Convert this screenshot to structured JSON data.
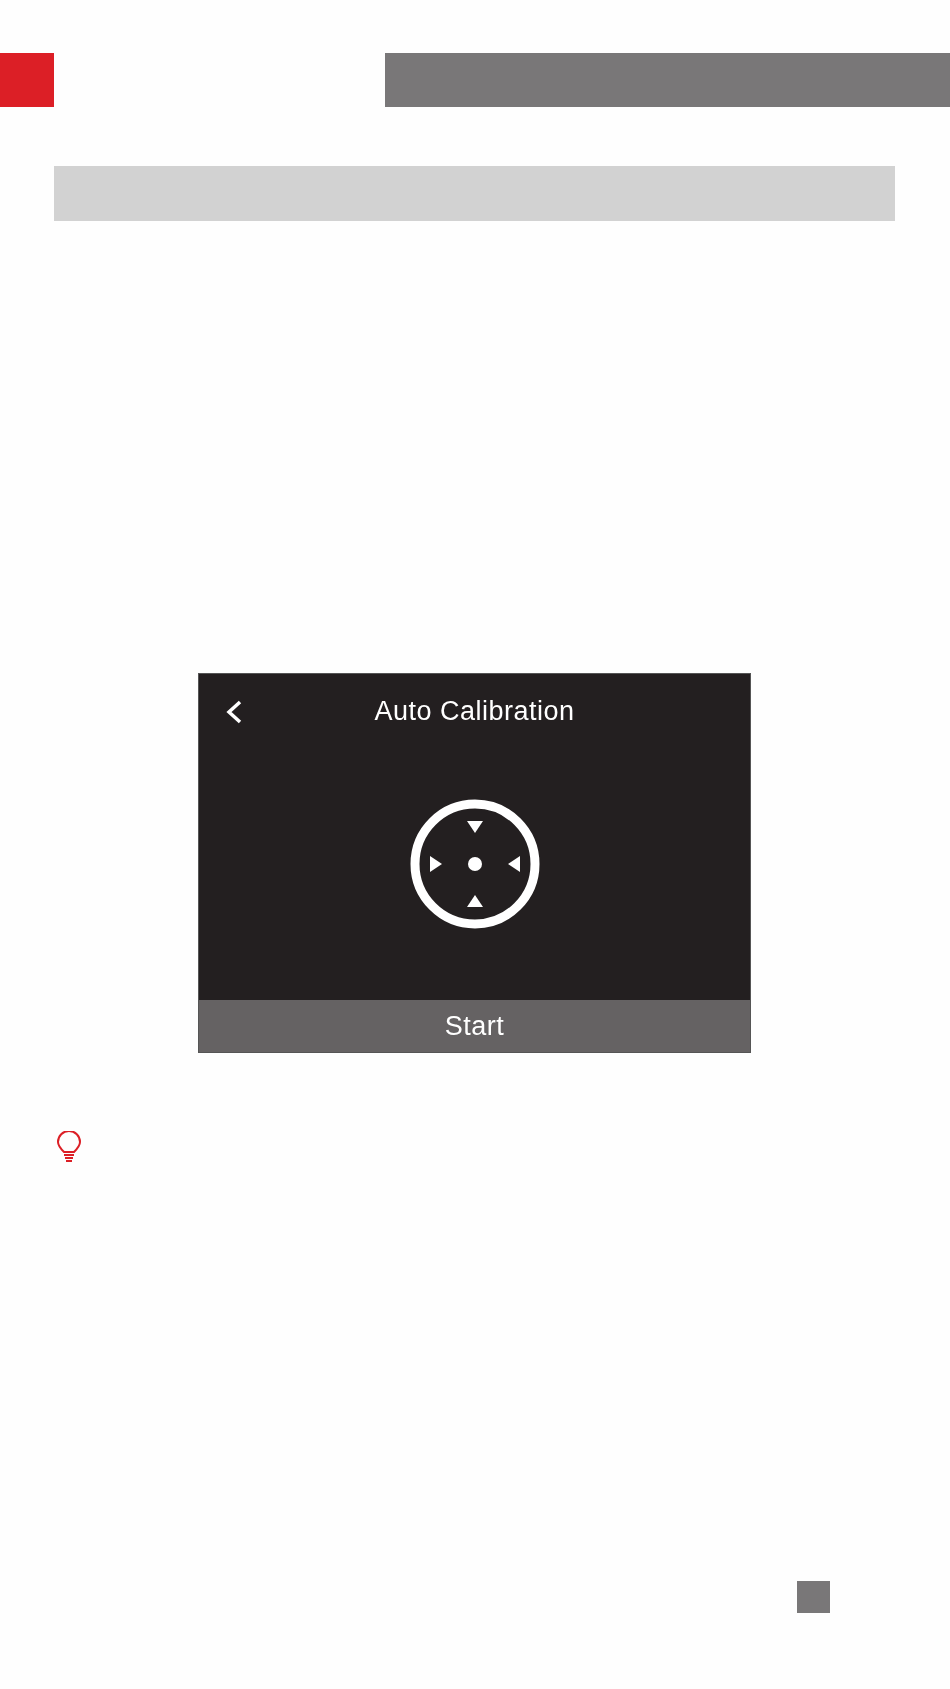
{
  "device_screen": {
    "title": "Auto Calibration",
    "start_button": "Start"
  }
}
